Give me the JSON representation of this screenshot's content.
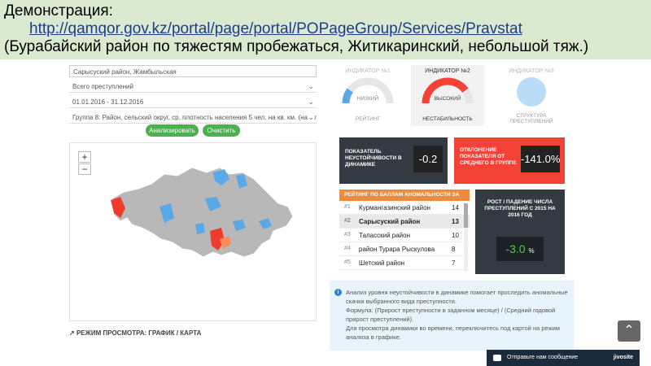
{
  "banner": {
    "line1": "Демонстрация:",
    "link": "http://qamqor.gov.kz/portal/page/portal/POPageGroup/Services/Pravstat",
    "line3": "(Бурабайский район по тяжестям пробежаться, Житикаринский, небольшой тяж.)"
  },
  "filters": {
    "region": "Сарысуский район, Жамбыльская",
    "crime": "Всего преступлений",
    "period": "01.01.2016 - 31.12.2016",
    "group": "Группа 8: Район, сельский округ, ср. плотность населения 5 чел. на кв. км. (населен",
    "analyze": "Анализировать",
    "clear": "Очистить"
  },
  "map": {
    "zoom_in": "+",
    "zoom_out": "−",
    "mode": "РЕЖИМ ПРОСМОТРА: ГРАФИК / КАРТА"
  },
  "indicators": [
    {
      "title": "ИНДИКАТОР №1",
      "level": "НИЗКИЙ",
      "caption": "РЕЙТИНГ",
      "level_fraction": 0.2
    },
    {
      "title": "ИНДИКАТОР №2",
      "level": "ВЫСОКИЙ",
      "caption": "НЕСТАБИЛЬНОСТЬ",
      "level_fraction": 0.8
    },
    {
      "title": "ИНДИКАТОР №3",
      "caption": "СТРУКТУРА ПРЕСТУПЛЕНИЙ"
    }
  ],
  "cards": {
    "instability": {
      "label": "ПОКАЗАТЕЛЬ НЕУСТОЙЧИВОСТИ В ДИНАМИКЕ",
      "value": "-0.2"
    },
    "deviation": {
      "label": "ОТКЛОНЕНИЕ ПОКАЗАТЕЛЯ ОТ СРЕДНЕГО В ГРУППЕ",
      "value": "-141.0%"
    },
    "growth": {
      "label": "РОСТ / ПАДЕНИЕ ЧИСЛА ПРЕСТУПЛЕНИЙ С 2015 НА 2016 ГОД",
      "value": "-3.0",
      "unit": "%"
    }
  },
  "rating": {
    "title": "РЕЙТИНГ ПО БАЛЛАМ АНОМАЛЬНОСТИ ЗА ГОД",
    "rows": [
      {
        "n": "#1",
        "name": "Курмангазинский район",
        "v": "14"
      },
      {
        "n": "#2",
        "name": "Сарысуский район",
        "v": "13"
      },
      {
        "n": "#3",
        "name": "Таласский район",
        "v": "10"
      },
      {
        "n": "#4",
        "name": "район Турара Рыскулова",
        "v": "8"
      },
      {
        "n": "#5",
        "name": "Шетский район",
        "v": "7"
      }
    ]
  },
  "info": {
    "icon": "i",
    "p1": "Анализ уровня неустойчивости в динамике помогает проследить аномальные скачки выбранного вида преступности.",
    "p2": "Формула: (Прирост преступности в заданном месяце) / (Средний годовой прирост преступлений).",
    "p3": "Для просмотра динамики во времени, переключитесь под картой на режим анализа в графике."
  },
  "chat": {
    "label": "Отправьте нам сообщение",
    "brand": "jivosite"
  },
  "colors": {
    "accent_green": "#4caf50",
    "danger": "#f44336",
    "dark": "#333a42",
    "orange": "#ee8a3b",
    "map_blue": "#5aa9e6",
    "map_grey": "#b3b3b3",
    "banner": "#d9ead0"
  }
}
